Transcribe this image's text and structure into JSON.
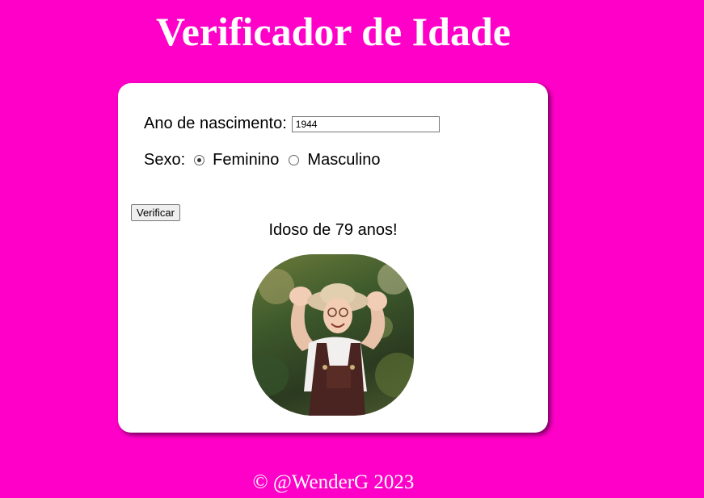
{
  "page": {
    "title": "Verificador de Idade",
    "footer": "© @WenderG 2023"
  },
  "form": {
    "year_label": "Ano de nascimento:",
    "year_value": "1944",
    "sex_label": "Sexo:",
    "options": [
      {
        "label": "Feminino",
        "checked": true
      },
      {
        "label": "Masculino",
        "checked": false
      }
    ],
    "verify_label": "Verificar"
  },
  "result": {
    "text": "Idoso de 79 anos!",
    "image_icon": "elderly-woman-photo"
  },
  "colors": {
    "background": "#ff00c8",
    "card": "#ffffff",
    "title_text": "#ffffff"
  }
}
